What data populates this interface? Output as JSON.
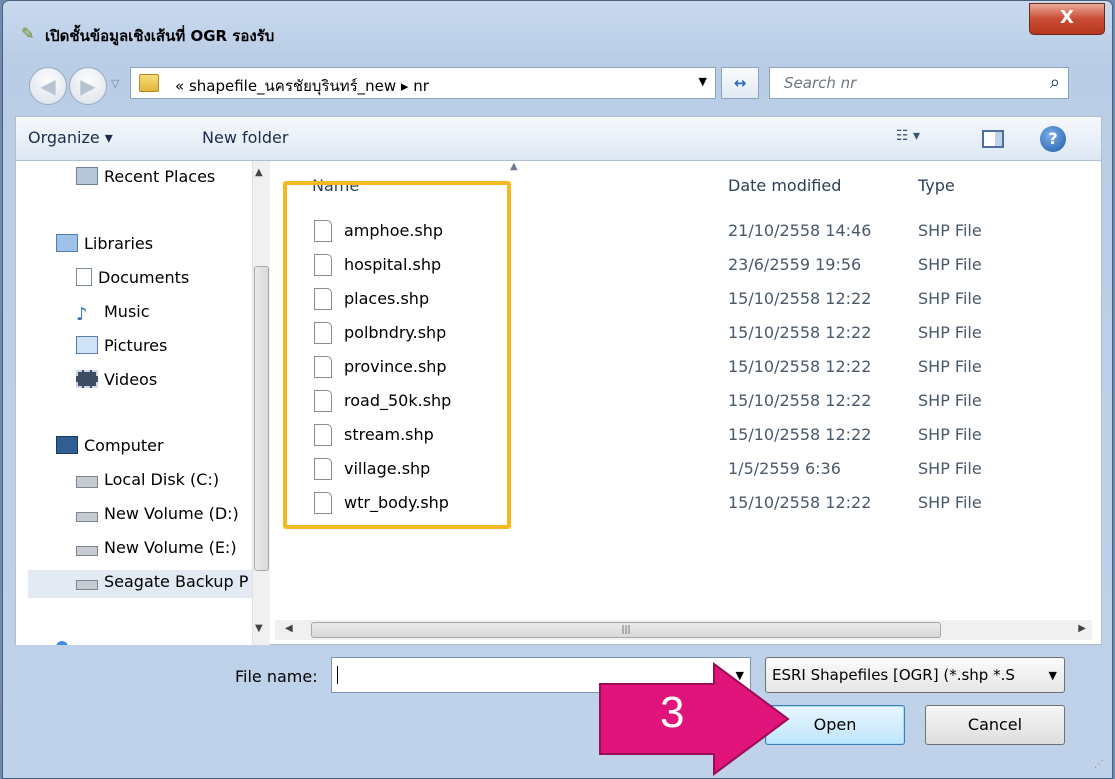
{
  "window": {
    "title": "เปิดชั้นข้อมูลเชิงเส้นที่ OGR รองรับ",
    "close_label": "X"
  },
  "nav": {
    "back_glyph": "◀",
    "forward_glyph": "▶",
    "address_path": "« shapefile_นครชัยบุรินทร์_new ▸ nr",
    "search_placeholder": "Search nr"
  },
  "toolbar": {
    "organize_label": "Organize ▾",
    "new_folder_label": "New folder",
    "views_label": "☷ ▾",
    "help_label": "?"
  },
  "sidebar": {
    "items": [
      {
        "label": "Recent Places",
        "icon": "recent-places-icon"
      },
      {
        "label": "Libraries",
        "icon": "libraries-icon"
      },
      {
        "label": "Documents",
        "icon": "documents-icon"
      },
      {
        "label": "Music",
        "icon": "music-icon"
      },
      {
        "label": "Pictures",
        "icon": "pictures-icon"
      },
      {
        "label": "Videos",
        "icon": "videos-icon"
      },
      {
        "label": "Computer",
        "icon": "computer-icon"
      },
      {
        "label": "Local Disk (C:)",
        "icon": "drive-icon"
      },
      {
        "label": "New Volume (D:)",
        "icon": "drive-icon"
      },
      {
        "label": "New Volume (E:)",
        "icon": "drive-icon"
      },
      {
        "label": "Seagate Backup P",
        "icon": "drive-icon"
      }
    ]
  },
  "file_list": {
    "columns": {
      "name": "Name",
      "date": "Date modified",
      "type": "Type"
    },
    "rows": [
      {
        "name": "amphoe.shp",
        "date": "21/10/2558 14:46",
        "type": "SHP File"
      },
      {
        "name": "hospital.shp",
        "date": "23/6/2559 19:56",
        "type": "SHP File"
      },
      {
        "name": "places.shp",
        "date": "15/10/2558 12:22",
        "type": "SHP File"
      },
      {
        "name": "polbndry.shp",
        "date": "15/10/2558 12:22",
        "type": "SHP File"
      },
      {
        "name": "province.shp",
        "date": "15/10/2558 12:22",
        "type": "SHP File"
      },
      {
        "name": "road_50k.shp",
        "date": "15/10/2558 12:22",
        "type": "SHP File"
      },
      {
        "name": "stream.shp",
        "date": "15/10/2558 12:22",
        "type": "SHP File"
      },
      {
        "name": "village.shp",
        "date": "1/5/2559 6:36",
        "type": "SHP File"
      },
      {
        "name": "wtr_body.shp",
        "date": "15/10/2558 12:22",
        "type": "SHP File"
      }
    ]
  },
  "footer": {
    "file_name_label": "File name:",
    "file_name_value": "",
    "filter_value": "ESRI Shapefiles [OGR] (*.shp *.S",
    "open_label": "Open",
    "cancel_label": "Cancel"
  },
  "annotation": {
    "step_number": "3",
    "arrow_color": "#e0147a",
    "highlight_color": "#f5b820"
  }
}
